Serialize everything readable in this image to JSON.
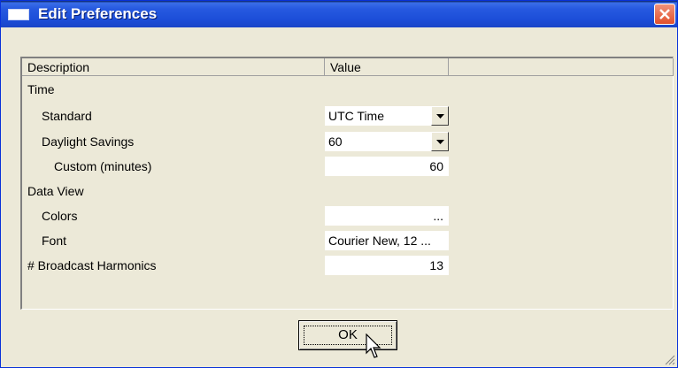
{
  "window": {
    "title": "Edit Preferences"
  },
  "grid": {
    "headers": {
      "description": "Description",
      "value": "Value"
    },
    "rows": [
      {
        "label": "Time",
        "value": ""
      },
      {
        "label": "Standard",
        "value": "UTC Time"
      },
      {
        "label": "Daylight Savings",
        "value": "60"
      },
      {
        "label": "Custom (minutes)",
        "value": "60"
      },
      {
        "label": "Data View",
        "value": ""
      },
      {
        "label": "Colors",
        "value": "..."
      },
      {
        "label": "Font",
        "value": "Courier New, 12 ..."
      },
      {
        "label": "# Broadcast Harmonics",
        "value": "13"
      }
    ]
  },
  "footer": {
    "ok_label": "OK"
  },
  "colors": {
    "title_blue": "#2659e0",
    "close_red": "#e2512c",
    "face": "#ece9d8"
  }
}
